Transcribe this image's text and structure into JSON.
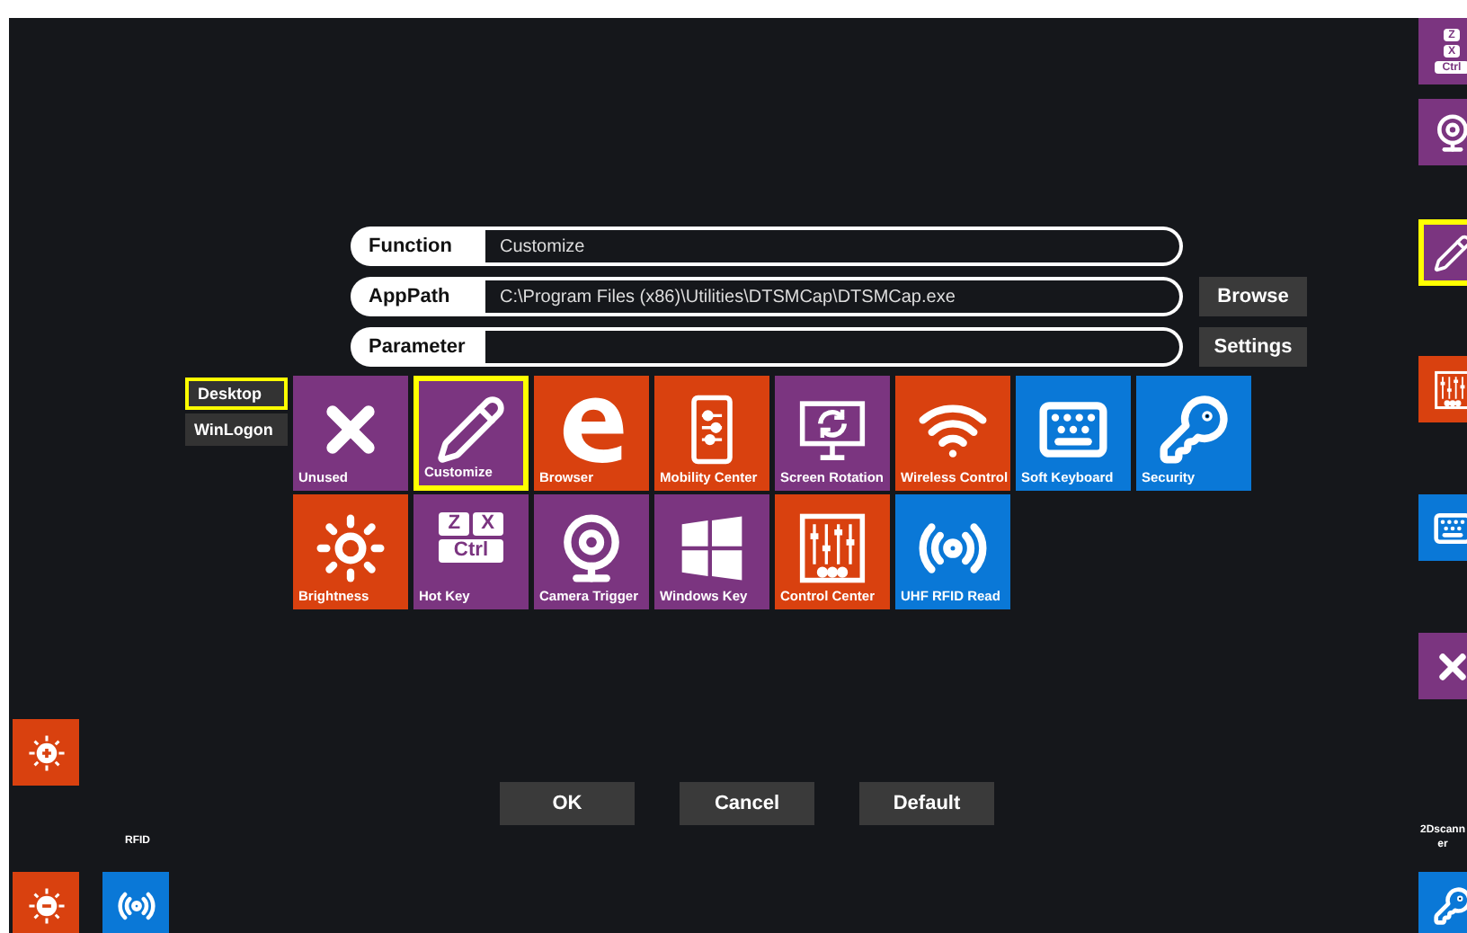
{
  "form": [
    {
      "label": "Function",
      "value": "Customize"
    },
    {
      "label": "AppPath",
      "value": "C:\\Program Files (x86)\\Utilities\\DTSMCap\\DTSMCap.exe",
      "button": "Browse"
    },
    {
      "label": "Parameter",
      "button": "Settings"
    }
  ],
  "modes": [
    {
      "label": "Desktop",
      "selected": true
    },
    {
      "label": "WinLogon",
      "selected": false
    }
  ],
  "tiles": [
    {
      "label": "Unused",
      "kind": "x",
      "color": "#7b3580",
      "selected": false
    },
    {
      "label": "Customize",
      "kind": "pencil",
      "color": "#7b3580",
      "selected": true
    },
    {
      "label": "Browser",
      "kind": "edge",
      "color": "#d9410f",
      "selected": false
    },
    {
      "label": "Mobility Center",
      "kind": "phone",
      "color": "#d9410f",
      "selected": false
    },
    {
      "label": "Screen Rotation",
      "kind": "rotate",
      "color": "#7b3580",
      "selected": false
    },
    {
      "label": "Wireless Control",
      "kind": "wifi",
      "color": "#d9410f",
      "selected": false
    },
    {
      "label": "Soft Keyboard",
      "kind": "keyboard",
      "color": "#0a78d7",
      "selected": false
    },
    {
      "label": "Security",
      "kind": "key",
      "color": "#0a78d7",
      "selected": false
    },
    {
      "label": "Brightness",
      "kind": "sun",
      "color": "#d9410f",
      "selected": false
    },
    {
      "label": "Hot Key",
      "kind": "hotkey",
      "keys": [
        "Z",
        "X",
        "Ctrl"
      ],
      "color": "#7b3580",
      "selected": false
    },
    {
      "label": "Camera Trigger",
      "kind": "camera",
      "color": "#7b3580",
      "selected": false
    },
    {
      "label": "Windows Key",
      "kind": "windows",
      "color": "#7b3580",
      "selected": false
    },
    {
      "label": "Control Center",
      "kind": "mixer",
      "color": "#d9410f",
      "selected": false
    },
    {
      "label": "UHF RFID Read",
      "kind": "radio",
      "color": "#0a78d7",
      "selected": false
    }
  ],
  "left_keys": [
    {
      "kind": "sunplus",
      "color": "#d9410f",
      "selected": false
    },
    {
      "kind": "sunminus",
      "color": "#d9410f",
      "selected": false
    },
    {
      "kind": "radio",
      "color": "#0a78d7",
      "selected": false,
      "label": "RFID"
    }
  ],
  "right_keys": [
    {
      "kind": "hotkey",
      "keys": [
        "Z",
        "X",
        "Ctrl"
      ],
      "color": "#7b3580",
      "selected": false
    },
    {
      "kind": "camera",
      "color": "#7b3580",
      "selected": false
    },
    {
      "kind": "pencil",
      "color": "#7b3580",
      "selected": true
    },
    {
      "kind": "mixer",
      "color": "#d9410f",
      "selected": false
    },
    {
      "kind": "keyboard",
      "color": "#0a78d7",
      "selected": false
    },
    {
      "kind": "x",
      "color": "#7b3580",
      "selected": false
    },
    {
      "kind": "key",
      "color": "#0a78d7",
      "selected": false,
      "label": "2Dscanner"
    }
  ],
  "actions": [
    "OK",
    "Cancel",
    "Default"
  ]
}
